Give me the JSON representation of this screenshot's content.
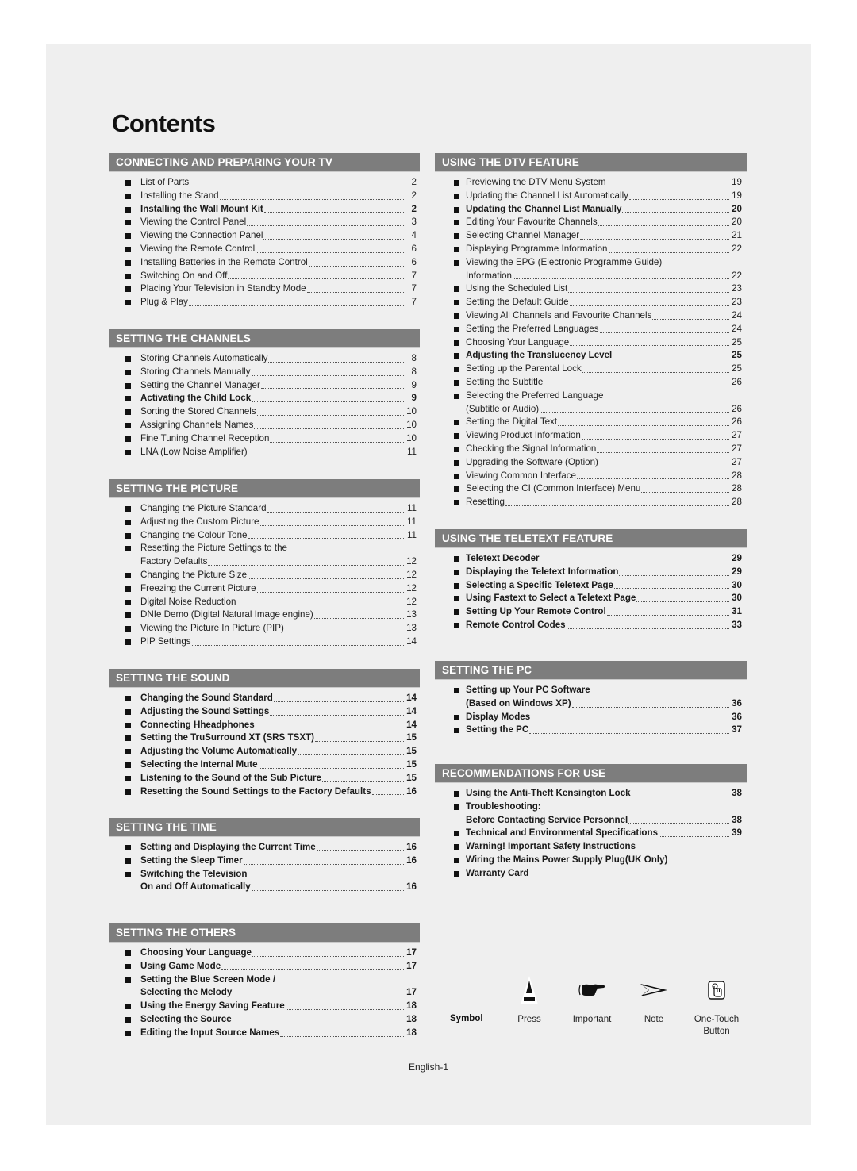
{
  "page": {
    "title": "Contents",
    "footer": "English-1"
  },
  "left_column": [
    {
      "heading": "CONNECTING AND PREPARING YOUR TV",
      "items": [
        {
          "text": "List of Parts",
          "page": "2"
        },
        {
          "text": "Installing the Stand",
          "page": "2"
        },
        {
          "text": "Installing the Wall Mount Kit",
          "page": "2",
          "bold": true
        },
        {
          "text": "Viewing the Control Panel",
          "page": "3"
        },
        {
          "text": "Viewing the Connection Panel",
          "page": "4"
        },
        {
          "text": "Viewing the Remote Control",
          "page": "6"
        },
        {
          "text": "Installing Batteries in the Remote Control",
          "page": "6"
        },
        {
          "text": "Switching On and Off",
          "page": "7"
        },
        {
          "text": "Placing Your Television in Standby Mode",
          "page": "7"
        },
        {
          "text": "Plug & Play",
          "page": "7"
        }
      ]
    },
    {
      "heading": "SETTING THE CHANNELS",
      "items": [
        {
          "text": "Storing Channels Automatically",
          "page": "8"
        },
        {
          "text": "Storing Channels Manually",
          "page": "8"
        },
        {
          "text": "Setting the Channel Manager",
          "page": "9"
        },
        {
          "text": "Activating the Child Lock",
          "page": "9",
          "bold": true
        },
        {
          "text": "Sorting the Stored Channels",
          "page": "10"
        },
        {
          "text": "Assigning Channels Names",
          "page": "10"
        },
        {
          "text": "Fine Tuning Channel Reception",
          "page": "10"
        },
        {
          "text": "LNA (Low Noise Amplifier)",
          "page": "11"
        }
      ]
    },
    {
      "heading": "SETTING THE PICTURE",
      "items": [
        {
          "text": "Changing the Picture Standard",
          "page": "11"
        },
        {
          "text": "Adjusting the Custom Picture",
          "page": "11"
        },
        {
          "text": "Changing the Colour Tone",
          "page": "11"
        },
        {
          "text": "Resetting the Picture Settings to the",
          "text2": "Factory Defaults",
          "page": "12"
        },
        {
          "text": "Changing the Picture Size",
          "page": "12"
        },
        {
          "text": "Freezing the Current Picture",
          "page": "12"
        },
        {
          "text": "Digital Noise Reduction",
          "page": "12"
        },
        {
          "text": "DNIe Demo (Digital Natural Image engine)",
          "page": "13"
        },
        {
          "text": "Viewing the Picture In Picture (PIP)",
          "page": "13"
        },
        {
          "text": "PIP Settings",
          "page": "14"
        }
      ]
    },
    {
      "heading": "SETTING THE SOUND",
      "items": [
        {
          "text": "Changing the Sound Standard",
          "page": "14",
          "bold": true
        },
        {
          "text": "Adjusting the Sound Settings",
          "page": "14",
          "bold": true
        },
        {
          "text": "Connecting Hheadphones",
          "page": "14",
          "bold": true
        },
        {
          "text": "Setting the TruSurround XT (SRS TSXT)",
          "page": "15",
          "bold": true
        },
        {
          "text": "Adjusting the Volume Automatically",
          "page": "15",
          "bold": true
        },
        {
          "text": "Selecting the Internal Mute",
          "page": "15",
          "bold": true
        },
        {
          "text": "Listening to the Sound of the Sub Picture",
          "page": "15",
          "bold": true
        },
        {
          "text": "Resetting the Sound Settings to the Factory Defaults",
          "page": "16",
          "bold": true
        }
      ]
    },
    {
      "heading": "SETTING THE TIME",
      "items": [
        {
          "text": "Setting and Displaying the Current Time",
          "page": "16",
          "bold": true
        },
        {
          "text": "Setting the Sleep Timer",
          "page": "16",
          "bold": true
        },
        {
          "text": "Switching the Television",
          "text2": "On and Off Automatically",
          "page": "16",
          "bold": true
        }
      ]
    },
    {
      "heading": "SETTING THE OTHERS",
      "items": [
        {
          "text": "Choosing Your Language",
          "page": "17",
          "bold": true
        },
        {
          "text": "Using Game Mode",
          "page": "17",
          "bold": true
        },
        {
          "text": "Setting the Blue Screen Mode /",
          "text2": "Selecting the Melody",
          "page": "17",
          "bold": true
        },
        {
          "text": "Using the Energy Saving Feature",
          "page": "18",
          "bold": true
        },
        {
          "text": "Selecting the Source",
          "page": "18",
          "bold": true
        },
        {
          "text": "Editing the Input Source Names",
          "page": "18",
          "bold": true
        }
      ]
    }
  ],
  "right_column": [
    {
      "heading": "USING THE DTV FEATURE",
      "items": [
        {
          "text": "Previewing the DTV Menu System",
          "page": "19"
        },
        {
          "text": "Updating the Channel List Automatically",
          "page": "19"
        },
        {
          "text": "Updating the Channel List Manually",
          "page": "20",
          "bold": true
        },
        {
          "text": "Editing Your Favourite Channels",
          "page": "20"
        },
        {
          "text": "Selecting Channel Manager",
          "page": "21"
        },
        {
          "text": "Displaying Programme Information",
          "page": "22"
        },
        {
          "text": "Viewing the EPG (Electronic Programme Guide)",
          "text2": "Information",
          "page": "22"
        },
        {
          "text": "Using the Scheduled List",
          "page": "23"
        },
        {
          "text": "Setting the Default Guide",
          "page": "23"
        },
        {
          "text": "Viewing All Channels and Favourite Channels",
          "page": "24"
        },
        {
          "text": "Setting the Preferred Languages",
          "page": "24"
        },
        {
          "text": "Choosing Your Language",
          "page": "25"
        },
        {
          "text": "Adjusting the Translucency Level",
          "page": "25",
          "bold": true
        },
        {
          "text": "Setting up the Parental Lock",
          "page": "25"
        },
        {
          "text": "Setting the Subtitle",
          "page": "26"
        },
        {
          "text": "Selecting the Preferred Language",
          "text2": "(Subtitle or Audio)",
          "page": "26"
        },
        {
          "text": "Setting the Digital Text",
          "page": "26"
        },
        {
          "text": "Viewing Product Information",
          "page": "27"
        },
        {
          "text": "Checking the Signal Information",
          "page": "27"
        },
        {
          "text": "Upgrading the Software (Option)",
          "page": "27"
        },
        {
          "text": "Viewing Common Interface",
          "page": "28"
        },
        {
          "text": "Selecting the CI (Common Interface) Menu",
          "page": "28"
        },
        {
          "text": "Resetting",
          "page": "28"
        }
      ]
    },
    {
      "heading": "USING THE TELETEXT FEATURE",
      "items": [
        {
          "text": "Teletext Decoder",
          "page": "29",
          "bold": true
        },
        {
          "text": "Displaying the Teletext Information",
          "page": "29",
          "bold": true
        },
        {
          "text": "Selecting a Specific Teletext Page",
          "page": "30",
          "bold": true
        },
        {
          "text": "Using Fastext to Select a Teletext Page",
          "page": "30",
          "bold": true
        },
        {
          "text": "Setting Up Your Remote Control",
          "page": "31",
          "bold": true
        },
        {
          "text": "Remote Control Codes",
          "page": "33",
          "bold": true
        }
      ]
    },
    {
      "heading": "SETTING THE PC",
      "items": [
        {
          "text": "Setting up Your PC Software",
          "text2": "(Based on Windows XP)",
          "page": "36",
          "bold": true
        },
        {
          "text": "Display Modes",
          "page": "36",
          "bold": true
        },
        {
          "text": "Setting the PC",
          "page": "37",
          "bold": true
        }
      ]
    },
    {
      "heading": "RECOMMENDATIONS FOR USE",
      "items": [
        {
          "text": "Using the Anti-Theft Kensington Lock",
          "page": "38",
          "bold": true
        },
        {
          "text": "Troubleshooting:",
          "text2": "Before Contacting Service Personnel",
          "page": "38",
          "bold": true
        },
        {
          "text": "Technical and Environmental Specifications",
          "page": "39",
          "bold": true
        },
        {
          "text": "Warning! Important Safety Instructions",
          "page": "",
          "bold": true
        },
        {
          "text": "Wiring the Mains Power Supply Plug(UK Only)",
          "page": "",
          "bold": true
        },
        {
          "text": "Warranty Card",
          "page": "",
          "bold": true
        }
      ]
    }
  ],
  "legend": {
    "heading": "Symbol",
    "symbols": [
      {
        "icon": "press-icon",
        "label": "Press"
      },
      {
        "icon": "pointing-hand-icon",
        "label": "Important"
      },
      {
        "icon": "arrow-note-icon",
        "label": "Note"
      },
      {
        "icon": "one-touch-button-icon",
        "label": "One-Touch",
        "label2": "Button"
      }
    ]
  }
}
